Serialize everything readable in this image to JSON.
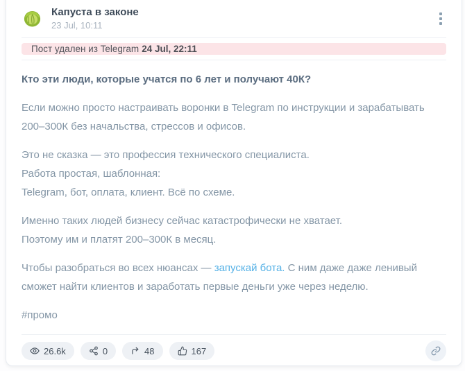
{
  "header": {
    "channel_name": "Капуста в законе",
    "post_date": "23 Jul, 10:11",
    "avatar_icon": "cabbage-icon",
    "menu_icon": "kebab-menu-icon"
  },
  "deleted_notice": {
    "text": "Пост удален из Telegram",
    "deleted_date": "24 Jul, 22:11"
  },
  "post": {
    "title": "Кто эти люди, которые учатся по 6 лет и получают 40К?",
    "paragraph_1": "Если можно просто настраивать воронки в Telegram по инструкции и зарабатывать 200–300К без начальства, стрессов и офисов.",
    "paragraph_2_line_1": "Это не сказка — это профессия технического специалиста.",
    "paragraph_2_line_2": "Работа простая, шаблонная:",
    "paragraph_2_line_3": "Telegram, бот, оплата, клиент. Всё по схеме.",
    "paragraph_3_line_1": "Именно таких людей бизнесу сейчас катастрофически не хватает.",
    "paragraph_3_line_2": "Поэтому им и платят 200–300К в месяц.",
    "paragraph_4_before_link": "Чтобы разобраться во всех нюансах — ",
    "paragraph_4_link": "запускай бота.",
    "paragraph_4_after_link": " С ним даже даже ленивый сможет найти клиентов и заработать первые деньги уже через неделю.",
    "hashtag": "#промо"
  },
  "stats": {
    "views": "26.6k",
    "shares": "0",
    "forwards": "48",
    "reactions": "167",
    "views_icon": "eye-icon",
    "shares_icon": "share-nodes-icon",
    "forwards_icon": "forward-arrow-icon",
    "reactions_icon": "thumbs-up-icon",
    "copy_link_icon": "link-icon"
  },
  "colors": {
    "link_blue": "#55b1e6",
    "notice_bg": "#fce4e7",
    "title_text": "#5b6d80",
    "body_text": "#8496a6",
    "pill_bg": "#eef1f5",
    "pill_text": "#47525e",
    "card_border": "#e8ecf1"
  }
}
